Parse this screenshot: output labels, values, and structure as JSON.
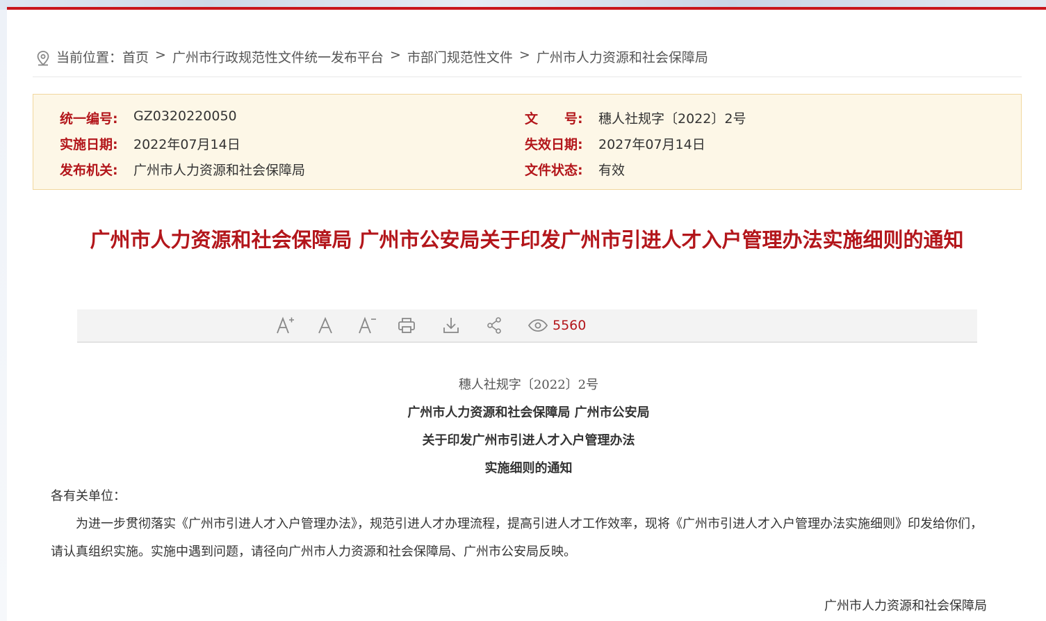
{
  "colors": {
    "accent_red": "#b3161b",
    "info_bg": "#fdf7e7",
    "info_border": "#f1d79e",
    "toolbar_bg": "#f3f3f3"
  },
  "breadcrumb": {
    "icon": "location-pin-icon",
    "prefix": "当前位置：",
    "items": [
      "首页",
      "广州市行政规范性文件统一发布平台",
      "市部门规范性文件",
      "广州市人力资源和社会保障局"
    ],
    "separator": ">"
  },
  "info": {
    "code_label": "统一编号:",
    "code_value": "GZ0320220050",
    "docno_label": "文　　号:",
    "docno_value": "穗人社规字〔2022〕2号",
    "start_label": "实施日期:",
    "start_value": "2022年07月14日",
    "expire_label": "失效日期:",
    "expire_value": "2027年07月14日",
    "issuer_label": "发布机关:",
    "issuer_value": "广州市人力资源和社会保障局",
    "status_label": "文件状态:",
    "status_value": "有效"
  },
  "title": "广州市人力资源和社会保障局 广州市公安局关于印发广州市引进人才入户管理办法实施细则的通知",
  "toolbar": {
    "icons": [
      "font-increase-icon",
      "font-default-icon",
      "font-decrease-icon",
      "print-icon",
      "download-icon",
      "share-icon",
      "eye-icon"
    ],
    "view_count": "5560"
  },
  "body": {
    "doc_number": "穗人社规字〔2022〕2号",
    "heading_line1": "广州市人力资源和社会保障局 广州市公安局",
    "heading_line2": "关于印发广州市引进人才入户管理办法",
    "heading_line3": "实施细则的通知",
    "salutation": "各有关单位：",
    "paragraph1": "为进一步贯彻落实《广州市引进人才入户管理办法》，规范引进人才办理流程，提高引进人才工作效率，现将《广州市引进人才入户管理办法实施细则》印发给你们，请认真组织实施。实施中遇到问题，请径向广州市人力资源和社会保障局、广州市公安局反映。",
    "signature": "广州市人力资源和社会保障局"
  }
}
